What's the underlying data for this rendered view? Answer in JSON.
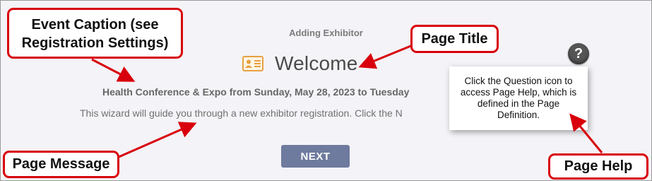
{
  "wizard": {
    "subtitle": "Adding Exhibitor",
    "title": "Welcome",
    "title_icon": "id-card-icon",
    "event_caption": "Health Conference & Expo from Sunday, May 28, 2023 to Tuesday",
    "page_message": "This wizard will guide you through a new exhibitor registration. Click the N",
    "next_label": "NEXT",
    "help_icon": "question-mark-icon",
    "help_glyph": "?",
    "help_tooltip": "Click the Question icon to access Page Help, which is defined in the Page Definition."
  },
  "annotations": {
    "event_caption": "Event Caption (see Registration Settings)",
    "page_title": "Page Title",
    "page_message": "Page Message",
    "page_help": "Page Help"
  },
  "colors": {
    "callout_border": "#d8000c",
    "arrow": "#d8000c",
    "next_button": "#6e7a9e",
    "icon_accent": "#e8a040",
    "background": "#f4f3f7"
  }
}
